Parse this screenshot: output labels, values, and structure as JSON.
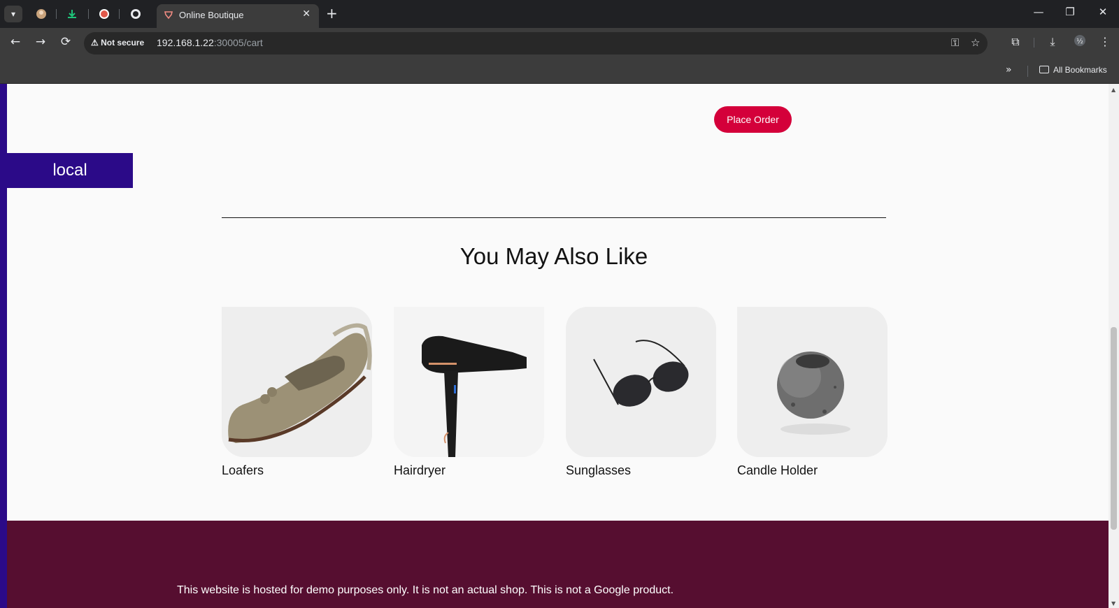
{
  "browser": {
    "tab_title": "Online Boutique",
    "tab_close": "✕",
    "new_tab": "+",
    "url_host": "192.168.1.22",
    "url_path": ":30005/cart",
    "security_label": "Not secure",
    "bookmarks_label": "All Bookmarks",
    "window_controls": {
      "minimize": "—",
      "restore": "❐",
      "close": "✕"
    },
    "icons": {
      "back": "←",
      "forward": "→",
      "reload": "⟳",
      "password": "⚿",
      "star": "☆",
      "extensions": "⧉",
      "download": "⤓",
      "menu": "⋮",
      "more": "»"
    }
  },
  "page": {
    "env_label": "local",
    "place_order_label": "Place Order",
    "recommendations": {
      "title": "You May Also Like",
      "items": [
        {
          "name": "Loafers",
          "icon": "loafers-image"
        },
        {
          "name": "Hairdryer",
          "icon": "hairdryer-image"
        },
        {
          "name": "Sunglasses",
          "icon": "sunglasses-image"
        },
        {
          "name": "Candle Holder",
          "icon": "candle-holder-image"
        }
      ]
    },
    "footer_text": "This website is hosted for demo purposes only. It is not an actual shop. This is not a Google product."
  },
  "colors": {
    "accent": "#d4003a",
    "env_badge": "#2b0a88",
    "footer": "#560e30"
  }
}
